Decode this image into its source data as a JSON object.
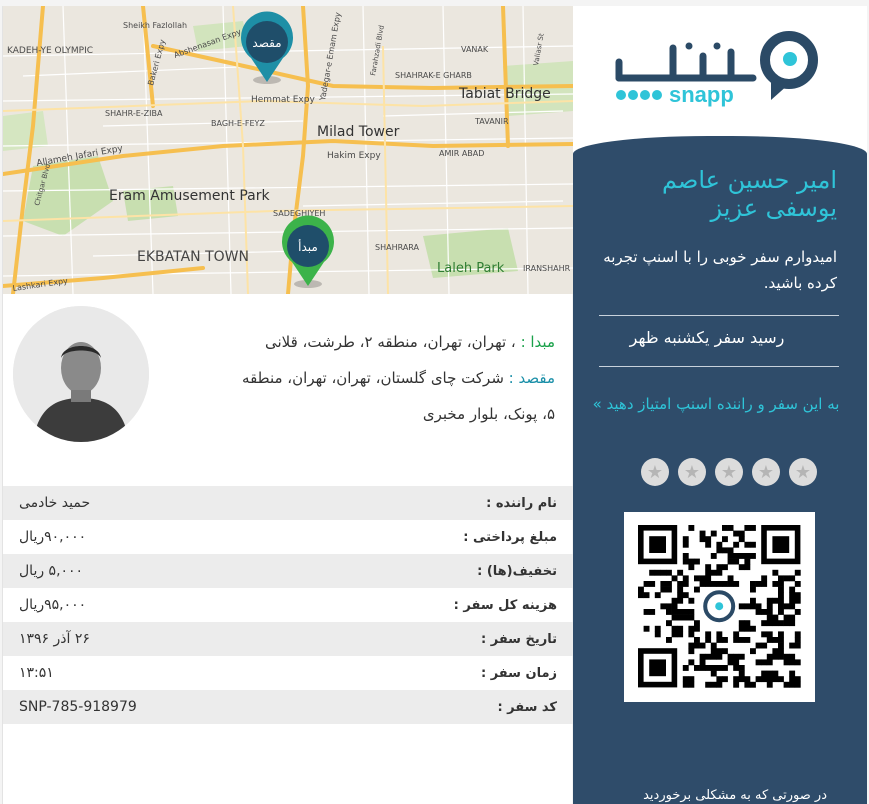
{
  "map": {
    "labels": {
      "kadeh": "KADEH-YE OLYMPIC",
      "azadegan": "Azadegan Expy",
      "sheikh": "Sheikh Fazlollah",
      "bakeri": "Bakeri Expy",
      "absh": "Abshenasan Expy",
      "yadegar": "Yadegar-e Emam Expy",
      "farahzadi": "Farahzadi Blvd",
      "vanak": "VANAK",
      "shahrak": "SHAHRAK-E GHARB",
      "valiasr": "Valiasr St",
      "tabiat": "Tabiat Bridge",
      "hemmat": "Hemmat Expy",
      "shahreziba": "SHAHR-E-ZIBA",
      "baghfeyz": "BAGH-E-FEYZ",
      "milad": "Milad Tower",
      "tavanir": "TAVANIR",
      "jafari": "Allameh Jafari Expy",
      "hakim": "Hakim Expy",
      "amirabad": "AMIR ABAD",
      "chitgar": "Chitgar Blvd",
      "eram": "Eram Amusement Park",
      "sadeghiyeh": "SADEGHIYEH",
      "ekbatan": "EKBATAN TOWN",
      "shahrara": "SHAHRARA",
      "laleh": "Laleh Park",
      "iranshahr": "IRANSHAHR",
      "lashkari": "Lashkari Expy"
    },
    "dest_pin_label": "مقصد",
    "origin_pin_label": "مبدأ",
    "dest_pin_color": "#1e8fa6",
    "origin_pin_color": "#3cb34a"
  },
  "trip": {
    "origin_label": "مبدا :",
    "origin_value": "، تهران، تهران، منطقه ۲، طرشت، قلانی",
    "dest_label": "مقصد :",
    "dest_value_1": "شرکت چای گلستان، تهران، تهران، منطقه",
    "dest_value_2": "۵، پونک، بلوار مخبری"
  },
  "details": [
    {
      "key": "نام راننده :",
      "value": "حمید خادمی"
    },
    {
      "key": "مبلغ پرداختی :",
      "value": "۹۰,۰۰۰ریال"
    },
    {
      "key": "تخفیف(ها) :",
      "value": "۵,۰۰۰ ریال"
    },
    {
      "key": "هزینه کل سفر :",
      "value": "۹۵,۰۰۰ریال"
    },
    {
      "key": "تاریخ سفر :",
      "value": "۲۶ آذر ۱۳۹۶"
    },
    {
      "key": "زمان سفر :",
      "value": "۱۳:۵۱"
    },
    {
      "key": "کد سفر :",
      "value": "SNP-785-918979"
    }
  ],
  "brand": {
    "logo_text_fa": "اسنپ",
    "logo_text_en": "snapp",
    "color": "#2b4a66",
    "accent": "#2fc4d8"
  },
  "panel": {
    "passenger_name": "امیر حسین عاصم یوسفی عزیز",
    "wish": "امیدوارم سفر خوبی را با اسنپ تجربه کرده باشید.",
    "receipt_title": "رسید سفر یکشنبه ظهر",
    "rate_prompt": "به این سفر و راننده اسنپ امتیاز دهید »",
    "stars": [
      "star-1",
      "star-2",
      "star-3",
      "star-4",
      "star-5"
    ],
    "footer": "در صورتی که به مشکلی برخوردید"
  }
}
